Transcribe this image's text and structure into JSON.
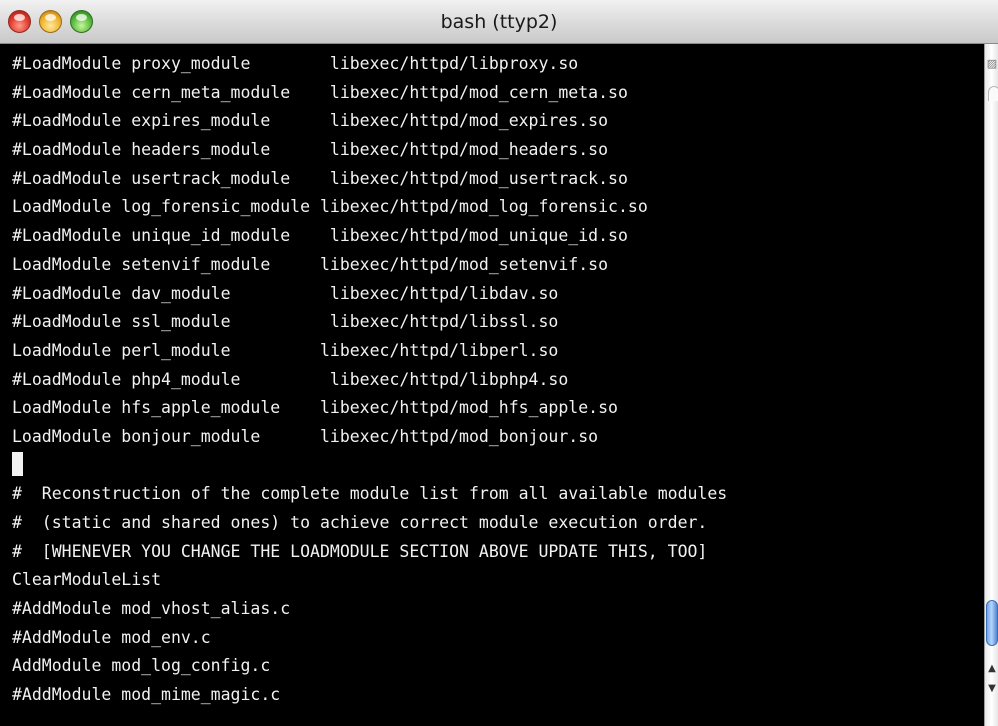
{
  "window": {
    "title": "bash (ttyp2)"
  },
  "terminal": {
    "lines": [
      "#LoadModule proxy_module        libexec/httpd/libproxy.so",
      "#LoadModule cern_meta_module    libexec/httpd/mod_cern_meta.so",
      "#LoadModule expires_module      libexec/httpd/mod_expires.so",
      "#LoadModule headers_module      libexec/httpd/mod_headers.so",
      "#LoadModule usertrack_module    libexec/httpd/mod_usertrack.so",
      "LoadModule log_forensic_module libexec/httpd/mod_log_forensic.so",
      "#LoadModule unique_id_module    libexec/httpd/mod_unique_id.so",
      "LoadModule setenvif_module     libexec/httpd/mod_setenvif.so",
      "#LoadModule dav_module          libexec/httpd/libdav.so",
      "#LoadModule ssl_module          libexec/httpd/libssl.so",
      "LoadModule perl_module         libexec/httpd/libperl.so",
      "#LoadModule php4_module         libexec/httpd/libphp4.so",
      "LoadModule hfs_apple_module    libexec/httpd/mod_hfs_apple.so",
      "LoadModule bonjour_module      libexec/httpd/mod_bonjour.so",
      "",
      "#  Reconstruction of the complete module list from all available modules",
      "#  (static and shared ones) to achieve correct module execution order.",
      "#  [WHENEVER YOU CHANGE THE LOADMODULE SECTION ABOVE UPDATE THIS, TOO]",
      "ClearModuleList",
      "#AddModule mod_vhost_alias.c",
      "#AddModule mod_env.c",
      "AddModule mod_log_config.c",
      "#AddModule mod_mime_magic.c"
    ],
    "cursor_line": 14
  },
  "icons": {
    "close": "close-icon",
    "minimize": "minimize-icon",
    "zoom": "zoom-icon",
    "resize": "resize-grip-icon",
    "scroll_up": "arrow-up-icon",
    "scroll_down": "arrow-down-icon"
  },
  "colors": {
    "terminal_bg": "#000000",
    "terminal_fg": "#f2f2f2",
    "scroll_thumb": "#6da2e8"
  }
}
